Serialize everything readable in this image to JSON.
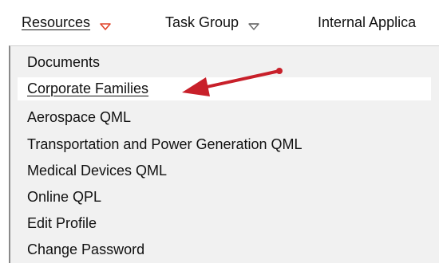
{
  "menubar": {
    "items": [
      {
        "label": "Resources",
        "active": true
      },
      {
        "label": "Task Group",
        "active": false
      },
      {
        "label": "Internal Applica",
        "active": false
      }
    ]
  },
  "dropdown": {
    "items": [
      {
        "label": "Documents"
      },
      {
        "label": "Corporate Families",
        "highlighted": true
      },
      {
        "label": "Aerospace QML"
      },
      {
        "label": "Transportation and Power Generation QML"
      },
      {
        "label": "Medical Devices QML"
      },
      {
        "label": "Online QPL"
      },
      {
        "label": "Edit Profile"
      },
      {
        "label": "Change Password"
      }
    ]
  },
  "icons": {
    "active_caret": "caret-down-icon",
    "inactive_caret": "caret-down-icon",
    "annotation": "red-arrow-icon"
  },
  "colors": {
    "active_caret": "#e0452a",
    "inactive_caret": "#6b6b6b",
    "arrow": "#c8202a",
    "dropdown_bg": "#f1f1f1",
    "highlight_bg": "#ffffff"
  }
}
